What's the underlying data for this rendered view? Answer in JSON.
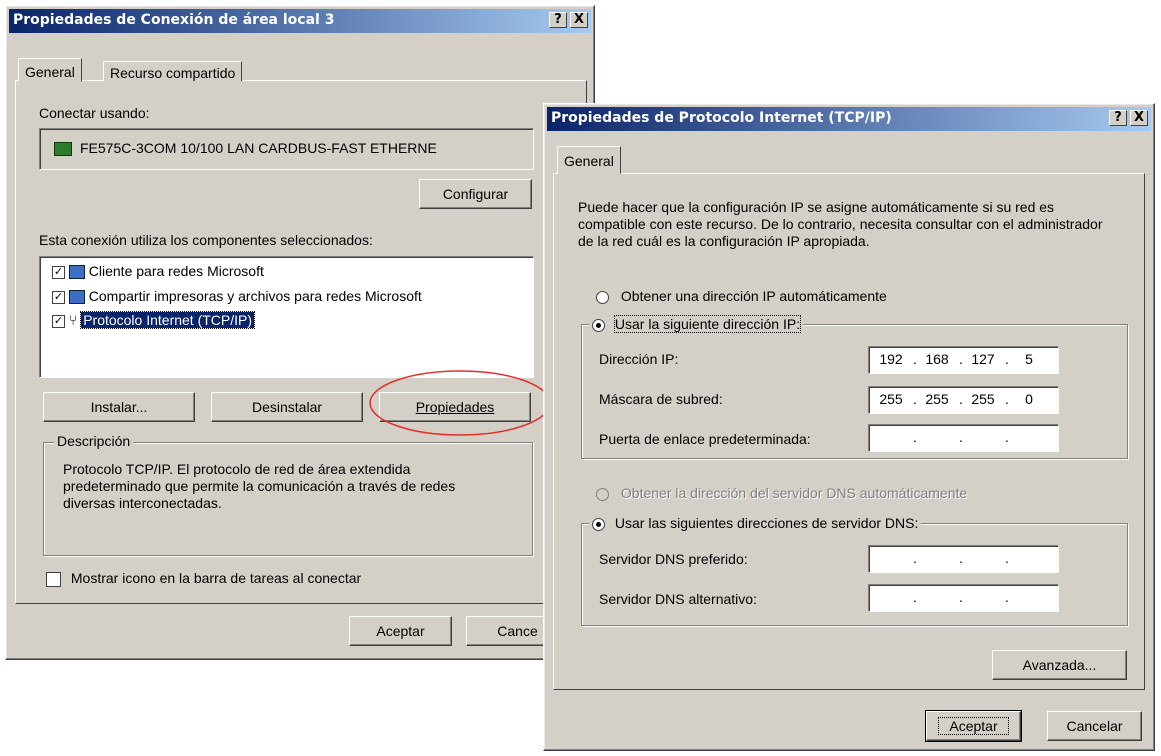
{
  "lan_dialog": {
    "title": "Propiedades de Conexión de área local 3",
    "tabs": [
      "General",
      "Recurso compartido"
    ],
    "connect_using_label": "Conectar usando:",
    "adapter_name": "FE575C-3COM 10/100 LAN CARDBUS-FAST ETHERNE",
    "configure_label": "Configurar",
    "components_label": "Esta conexión utiliza los componentes seleccionados:",
    "components": [
      {
        "label": "Cliente para redes Microsoft",
        "checked": true,
        "icon": "network-client-icon"
      },
      {
        "label": "Compartir impresoras y archivos para redes Microsoft",
        "checked": true,
        "icon": "file-printer-sharing-icon"
      },
      {
        "label": "Protocolo Internet (TCP/IP)",
        "checked": true,
        "icon": "network-protocol-icon",
        "selected": true
      }
    ],
    "install_label": "Instalar...",
    "uninstall_label": "Desinstalar",
    "properties_label": "Propiedades",
    "description_legend": "Descripción",
    "description_text": "Protocolo TCP/IP. El protocolo de red de área extendida predeterminado que permite la comunicación a través de redes diversas interconectadas.",
    "show_icon_label": "Mostrar icono en la barra de tareas al conectar",
    "show_icon_checked": false,
    "ok_label": "Aceptar",
    "cancel_label": "Cance",
    "highlight_color": "#e0302a"
  },
  "tcpip_dialog": {
    "title": "Propiedades de Protocolo Internet (TCP/IP)",
    "tab": "General",
    "intro_text": "Puede hacer que la configuración IP se asigne automáticamente si su red es compatible con este recurso. De lo contrario, necesita consultar con el administrador de la red cuál es la configuración IP apropiada.",
    "auto_ip_label": "Obtener una dirección IP automáticamente",
    "manual_ip_label": "Usar la siguiente dirección IP:",
    "ip_label": "Dirección IP:",
    "ip_value": [
      "192",
      "168",
      "127",
      "5"
    ],
    "mask_label": "Máscara de subred:",
    "mask_value": [
      "255",
      "255",
      "255",
      "0"
    ],
    "gateway_label": "Puerta de enlace predeterminada:",
    "gateway_value": [
      "",
      "",
      "",
      ""
    ],
    "auto_dns_label": "Obtener la dirección del servidor DNS automáticamente",
    "manual_dns_label": "Usar las siguientes direcciones de servidor DNS:",
    "preferred_dns_label": "Servidor DNS preferido:",
    "preferred_dns_value": [
      "",
      "",
      "",
      ""
    ],
    "alternate_dns_label": "Servidor DNS alternativo:",
    "alternate_dns_value": [
      "",
      "",
      "",
      ""
    ],
    "advanced_label": "Avanzada...",
    "ok_label": "Aceptar",
    "cancel_label": "Cancelar",
    "help_button": "?",
    "close_button": "X"
  }
}
